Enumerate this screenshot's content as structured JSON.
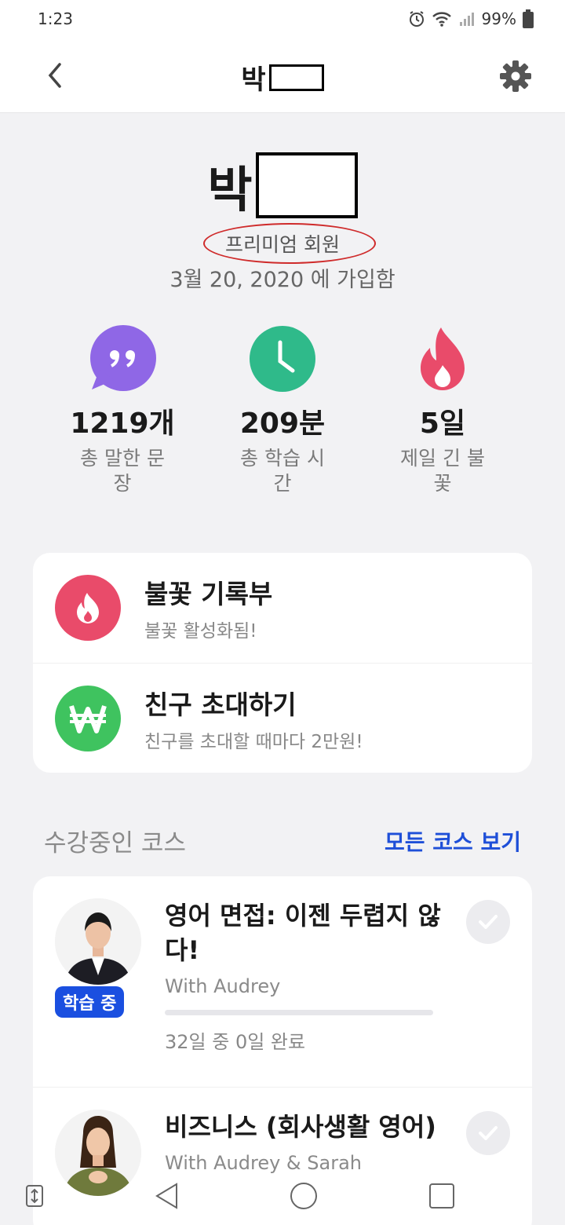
{
  "status_bar": {
    "time": "1:23",
    "battery": "99%"
  },
  "header": {
    "title": "박"
  },
  "profile": {
    "name": "박",
    "membership": "프리미엄 회원",
    "joined": "3월 20, 2020  에 가입함"
  },
  "stats": [
    {
      "value": "1219개",
      "label": "총 말한 문장",
      "icon": "quote-bubble-icon",
      "color": "#8f67e6"
    },
    {
      "value": "209분",
      "label": "총 학습 시간",
      "icon": "clock-icon",
      "color": "#2fba8a"
    },
    {
      "value": "5일",
      "label": "제일 긴 불꽃",
      "icon": "flame-icon",
      "color": "#e94b6a"
    }
  ],
  "menu": [
    {
      "title": "불꽃 기록부",
      "subtitle": "불꽃 활성화됨!",
      "icon": "flame-icon",
      "color": "#e94b6a"
    },
    {
      "title": "친구 초대하기",
      "subtitle": "친구를 초대할 때마다 2만원!",
      "icon": "won-icon",
      "color": "#3fc35f"
    }
  ],
  "courses_section": {
    "title": "수강중인 코스",
    "link": "모든 코스 보기"
  },
  "courses": [
    {
      "title": "영어 면접: 이젠 두렵지 않다!",
      "teacher": "With Audrey",
      "progress_text": "32일 중 0일 완료",
      "progress": 0,
      "badge": "학습 중"
    },
    {
      "title": "비즈니스 (회사생활 영어)",
      "teacher": "With Audrey & Sarah"
    }
  ],
  "colors": {
    "accent": "#1a4fe0",
    "annotation": "#cf2b2b"
  }
}
